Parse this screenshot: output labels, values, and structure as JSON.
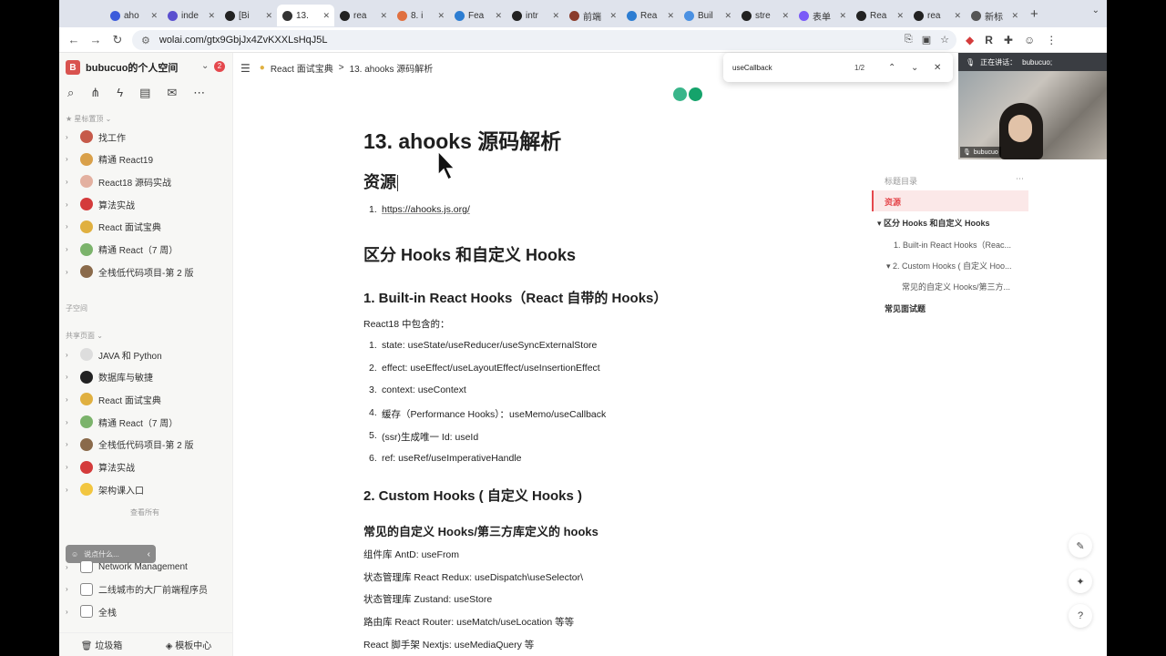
{
  "browser": {
    "tabs": [
      {
        "label": "aho",
        "active": false
      },
      {
        "label": "inde",
        "active": false
      },
      {
        "label": "[Bi",
        "active": false
      },
      {
        "label": "13.",
        "active": true
      },
      {
        "label": "rea",
        "active": false
      },
      {
        "label": "8. i",
        "active": false
      },
      {
        "label": "Fea",
        "active": false
      },
      {
        "label": "intr",
        "active": false
      },
      {
        "label": "前端",
        "active": false
      },
      {
        "label": "Rea",
        "active": false
      },
      {
        "label": "Buil",
        "active": false
      },
      {
        "label": "stre",
        "active": false
      },
      {
        "label": "表单",
        "active": false
      },
      {
        "label": "Rea",
        "active": false
      },
      {
        "label": "rea",
        "active": false
      },
      {
        "label": "新标",
        "active": false
      }
    ],
    "url": "wolai.com/gtx9GbjJx4ZvKXXLsHqJ5L"
  },
  "sidebar": {
    "space_name": "bubucuo的个人空间",
    "space_initial": "B",
    "notification_count": "2",
    "starred_label": "星标置顶",
    "starred_items": [
      {
        "label": "找工作",
        "color": "#c65a4a"
      },
      {
        "label": "精通 React19",
        "color": "#d9a04a"
      },
      {
        "label": "React18 源码实战",
        "color": "#e3b0a0"
      },
      {
        "label": "算法实战",
        "color": "#d43b3b"
      },
      {
        "label": "React 面试宝典",
        "color": "#e0b040"
      },
      {
        "label": "精通 React（7 周）",
        "color": "#7bb36b"
      },
      {
        "label": "全栈低代码项目-第 2 版",
        "color": "#8a6a4a"
      }
    ],
    "subspace_label": "子空间",
    "shared_label": "共享页面",
    "shared_items": [
      {
        "label": "JAVA 和 Python",
        "color": "#dddddd"
      },
      {
        "label": "数据库与敏捷",
        "color": "#222222"
      },
      {
        "label": "React 面试宝典",
        "color": "#e0b040"
      },
      {
        "label": "精通 React（7 周）",
        "color": "#7bb36b"
      },
      {
        "label": "全栈低代码项目-第 2 版",
        "color": "#8a6a4a"
      },
      {
        "label": "算法实战",
        "color": "#d43b3b"
      },
      {
        "label": "架构课入口",
        "color": "#f2c640"
      }
    ],
    "see_all": "查看所有",
    "tooltip_text": "说点什么...",
    "other_items": [
      {
        "label": "Network Management"
      },
      {
        "label": "二线城市的大厂前端程序员"
      },
      {
        "label": "全栈"
      }
    ],
    "trash_label": "垃圾箱",
    "templates_label": "模板中心"
  },
  "breadcrumb": {
    "parent": "React 面试宝典",
    "separator": ">",
    "current": "13. ahooks 源码解析"
  },
  "findbar": {
    "query": "useCallback",
    "count": "1/2"
  },
  "video": {
    "speaking_label": "正在讲话：",
    "speaker": "bubucuo;",
    "name_tag": "bubucuo"
  },
  "doc": {
    "title": "13. ahooks 源码解析",
    "resources_heading": "资源",
    "resources": [
      {
        "num": "1.",
        "text": "https://ahooks.js.org/"
      }
    ],
    "section_heading": "区分 Hooks 和自定义 Hooks",
    "builtin_heading": "1. Built-in React Hooks（React 自带的 Hooks）",
    "builtin_intro": "React18 中包含的：",
    "builtin_list": [
      {
        "num": "1.",
        "text": "state: useState/useReducer/useSyncExternalStore"
      },
      {
        "num": "2.",
        "text": "effect: useEffect/useLayoutEffect/useInsertionEffect"
      },
      {
        "num": "3.",
        "text": "context: useContext"
      },
      {
        "num": "4.",
        "text": "缓存（Performance Hooks）：useMemo/useCallback"
      },
      {
        "num": "5.",
        "text": "(ssr)生成唯一 Id: useId"
      },
      {
        "num": "6.",
        "text": "ref: useRef/useImperativeHandle"
      }
    ],
    "custom_heading": "2. Custom Hooks ( 自定义 Hooks )",
    "thirdparty_heading": "常见的自定义 Hooks/第三方库定义的 hooks",
    "thirdparty_list": [
      "组件库 AntD: useFrom",
      "状态管理库 React Redux: useDispatch\\useSelector\\",
      "状态管理库 Zustand: useStore",
      "路由库 React Router: useMatch/useLocation 等等",
      "React 脚手架 Nextjs: useMediaQuery 等"
    ]
  },
  "toc": {
    "title": "标题目录",
    "items": [
      {
        "label": "资源",
        "active": true
      },
      {
        "label": "▾ 区分 Hooks 和自定义 Hooks"
      },
      {
        "label": "1. Built-in React Hooks（Reac..."
      },
      {
        "label": "▾ 2. Custom Hooks ( 自定义 Hoo..."
      },
      {
        "label": "常见的自定义 Hooks/第三方..."
      },
      {
        "label": "常见面试题"
      }
    ]
  },
  "colors": {
    "accent": "#e5484d",
    "toc_active_bg": "#fbe8e8"
  }
}
